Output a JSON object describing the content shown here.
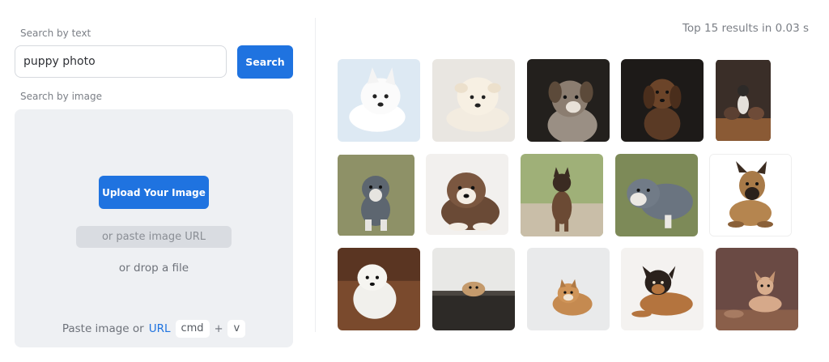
{
  "text_search": {
    "label": "Search by text",
    "value": "puppy photo",
    "button_label": "Search"
  },
  "image_search": {
    "label": "Search by image",
    "upload_label": "Upload Your Image",
    "url_placeholder": "or paste image URL",
    "drop_text": "or drop a file",
    "paste_prefix": "Paste image or",
    "paste_link": "URL",
    "key_cmd": "cmd",
    "key_plus": "+",
    "key_v": "v"
  },
  "results": {
    "summary": "Top 15 results in 0.03 s",
    "count": 15
  },
  "colors": {
    "accent": "#1f73e0",
    "panel_bg": "#eef0f3"
  }
}
